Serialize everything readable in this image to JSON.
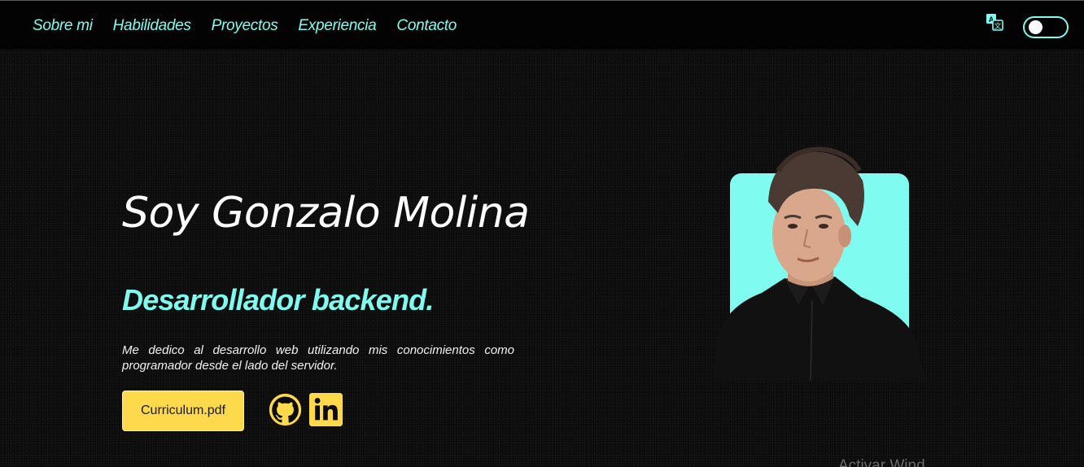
{
  "nav": {
    "links": [
      "Sobre mi",
      "Habilidades",
      "Proyectos",
      "Experiencia",
      "Contacto"
    ],
    "translate_icon": "translate-icon",
    "theme_toggle": "toggle-switch"
  },
  "hero": {
    "name": "Soy Gonzalo Molina",
    "role": "Desarrollador backend.",
    "description": "Me dedico al desarrollo web utilizando mis conocimientos como programador desde el lado del servidor.",
    "cv_button": "Curriculum.pdf",
    "social": {
      "github_icon": "github-icon",
      "linkedin_icon": "linkedin-icon"
    },
    "photo": "profile-photo"
  },
  "watermark": {
    "text": "Activar Wind"
  },
  "colors": {
    "accent": "#7ffcef",
    "button": "#ffd94c",
    "background": "#0b0b0b",
    "navbar": "#030303"
  }
}
